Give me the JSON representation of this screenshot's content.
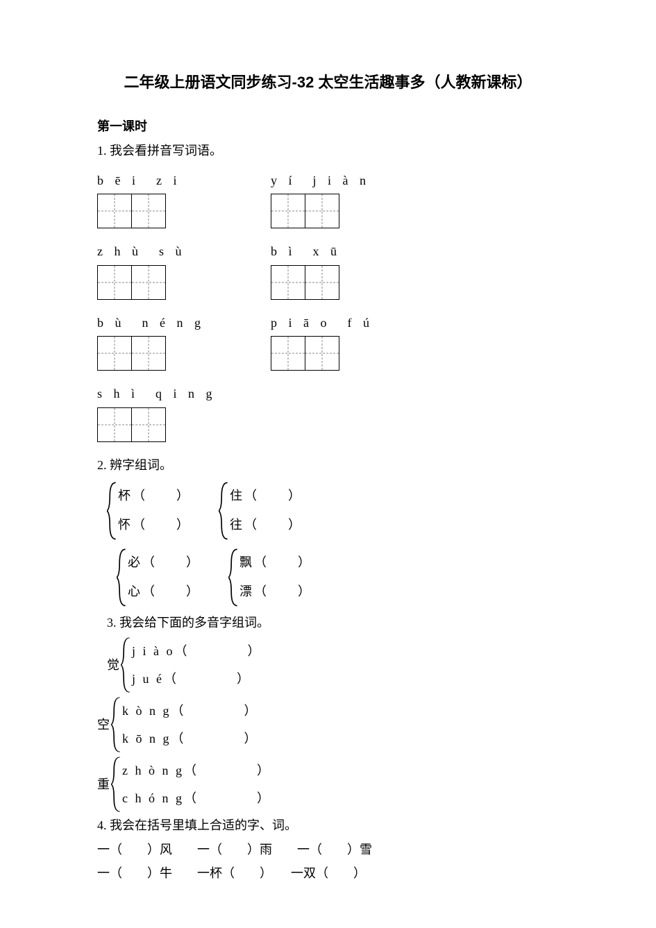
{
  "title": "二年级上册语文同步练习-32 太空生活趣事多（人教新课标）",
  "lesson_header": "第一课时",
  "q1": {
    "prompt": "1. 我会看拼音写词语。",
    "row1": [
      "b ē i　z i",
      "y í　j i à n"
    ],
    "row2": [
      "z h ù　s ù",
      "b ì　x ū"
    ],
    "row3": [
      "b ù　n é n g",
      "p i ā o　f ú"
    ],
    "row4": [
      "s h ì　q i n g"
    ]
  },
  "q2": {
    "prompt": "2. 辨字组词。",
    "pair1a": "杯（　　）",
    "pair1b": "怀（　　）",
    "pair2a": "住（　　）",
    "pair2b": "往（　　）",
    "pair3a": "必（　　）",
    "pair3b": "心（　　）",
    "pair4a": "飘（　　）",
    "pair4b": "漂（　　）"
  },
  "q3": {
    "prompt": "3. 我会给下面的多音字组词。",
    "g1_label": "觉",
    "g1_line1": "j i à o（　　　　）",
    "g1_line2": "j u é（　　　　）",
    "g2_label": "空",
    "g2_line1": "k ò n g（　　　　）",
    "g2_line2": "k ō n g（　　　　）",
    "g3_label": "重",
    "g3_line1": "z h ò n g（　　　　）",
    "g3_line2": "c h ó n g（　　　　）"
  },
  "q4": {
    "prompt": "4. 我会在括号里填上合适的字、词。",
    "line1": "一（　　）风　　一（　　）雨　　一（　　）雪",
    "line2": "一（　　）牛　　一杯（　　）　　一双（　　）"
  }
}
